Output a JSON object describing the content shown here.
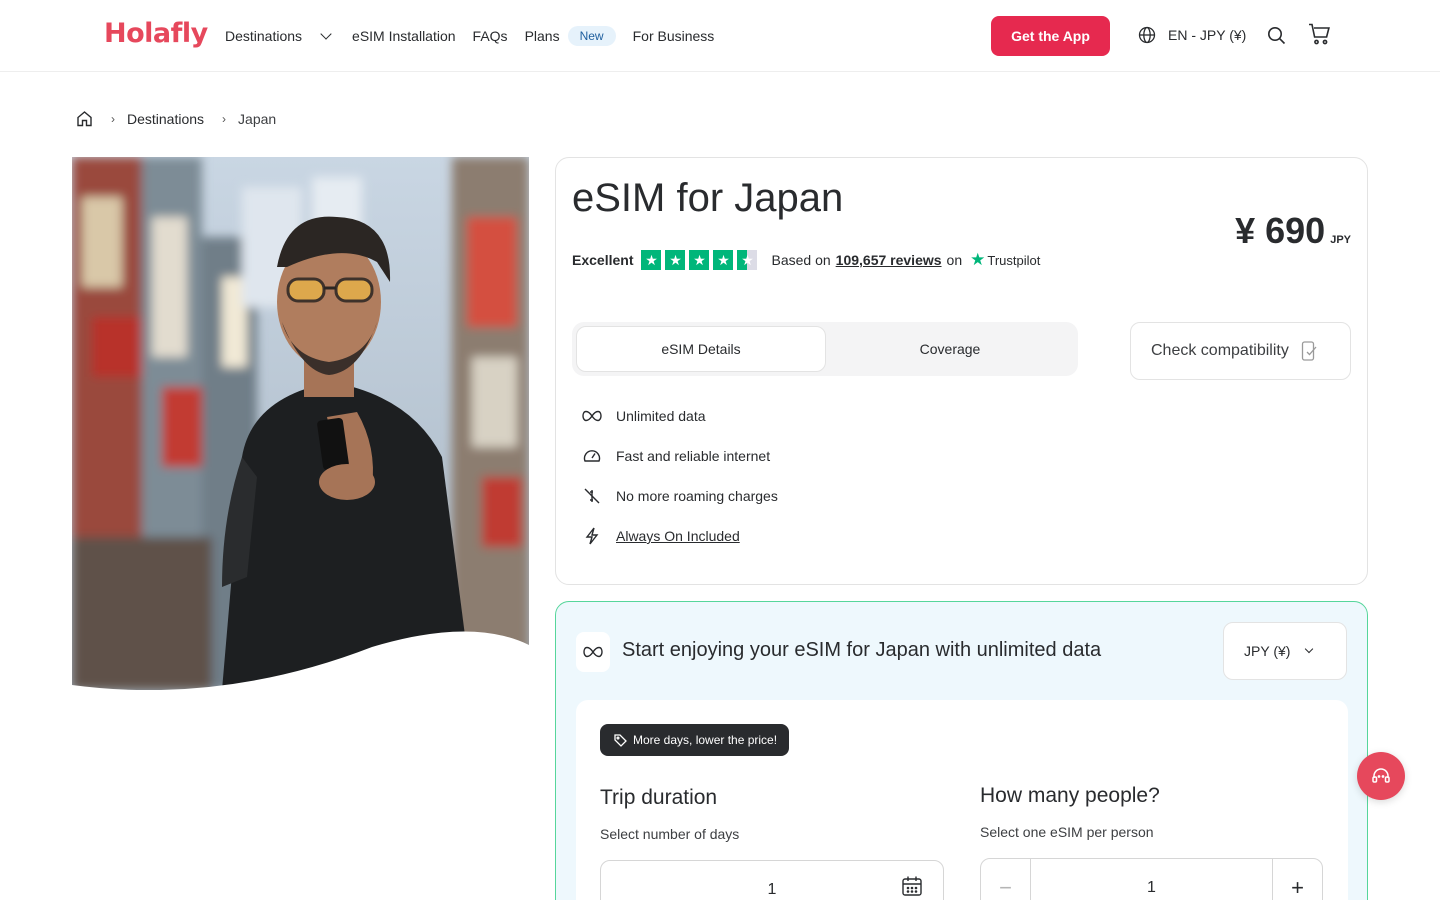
{
  "brand": {
    "logo": "Holafly",
    "accent": "#e6294f"
  },
  "nav": {
    "destinations": "Destinations",
    "installation": "eSIM Installation",
    "faqs": "FAQs",
    "plans": "Plans",
    "plans_badge": "New",
    "business": "For Business"
  },
  "header": {
    "get_app": "Get the App",
    "language": "EN - JPY (¥)"
  },
  "breadcrumb": {
    "home_icon": "home-icon",
    "items": [
      "Destinations",
      "Japan"
    ]
  },
  "product": {
    "title": "eSIM for Japan",
    "price": "¥ 690",
    "price_currency": "JPY",
    "rating_label": "Excellent",
    "rating_stars": 4.5,
    "reviews_prefix": "Based on",
    "reviews_count": "109,657 reviews",
    "reviews_suffix": "on",
    "trustpilot": "Trustpilot",
    "tabs": [
      "eSIM Details",
      "Coverage"
    ],
    "check_compat": "Check compatibility",
    "features": [
      {
        "icon": "infinity-icon",
        "label": "Unlimited data"
      },
      {
        "icon": "speedometer-icon",
        "label": "Fast and reliable internet"
      },
      {
        "icon": "no-roaming-icon",
        "label": "No more roaming charges"
      },
      {
        "icon": "lightning-icon",
        "label": "Always On Included"
      }
    ]
  },
  "plan": {
    "title": "Start enjoying your eSIM for Japan with unlimited data",
    "currency": "JPY (¥)",
    "deal_badge": "More days, lower the price!",
    "trip_title": "Trip duration",
    "trip_sub": "Select number of days",
    "trip_value": "1",
    "people_title": "How many people?",
    "people_sub": "Select one eSIM per person",
    "people_value": "1"
  }
}
